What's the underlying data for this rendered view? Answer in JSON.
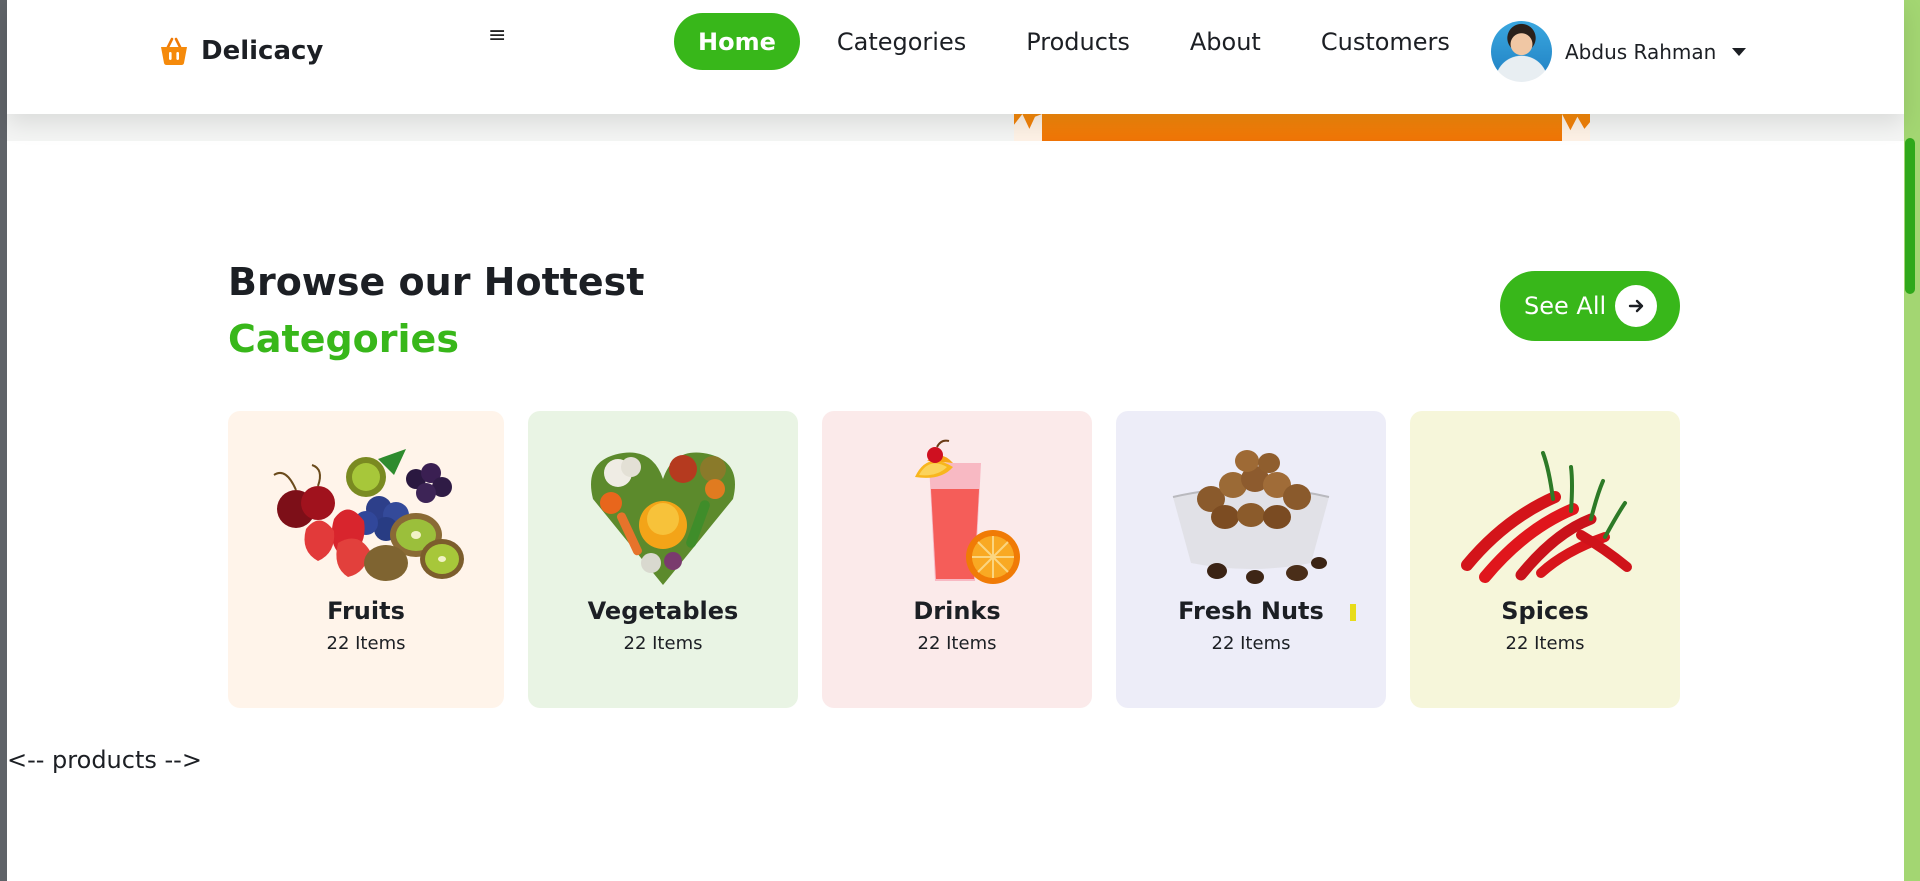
{
  "header": {
    "brand": "Delicacy",
    "menu_icon": "≡",
    "nav": [
      {
        "label": "Home",
        "active": true
      },
      {
        "label": "Categories",
        "active": false
      },
      {
        "label": "Products",
        "active": false
      },
      {
        "label": "About",
        "active": false
      },
      {
        "label": "Customers",
        "active": false
      }
    ],
    "user_name": "Abdus Rahman"
  },
  "categories_section": {
    "title_line1": "Browse our Hottest",
    "title_line2": "Categories",
    "see_all_label": "See All",
    "items": [
      {
        "name": "Fruits",
        "count": "22 Items",
        "bg": "#fff4ea",
        "icon": "fruits-image"
      },
      {
        "name": "Vegetables",
        "count": "22 Items",
        "bg": "#e9f4e4",
        "icon": "vegetables-image"
      },
      {
        "name": "Drinks",
        "count": "22 Items",
        "bg": "#fbeaea",
        "icon": "drinks-image"
      },
      {
        "name": "Fresh Nuts",
        "count": "22 Items",
        "bg": "#ededf8",
        "icon": "nuts-image"
      },
      {
        "name": "Spices",
        "count": "22 Items",
        "bg": "#f6f6da",
        "icon": "spices-image"
      }
    ]
  },
  "comment_text": "<-- products -->",
  "colors": {
    "accent": "#38b71a",
    "brand_orange": "#f58a0b",
    "text": "#1c1f24"
  }
}
